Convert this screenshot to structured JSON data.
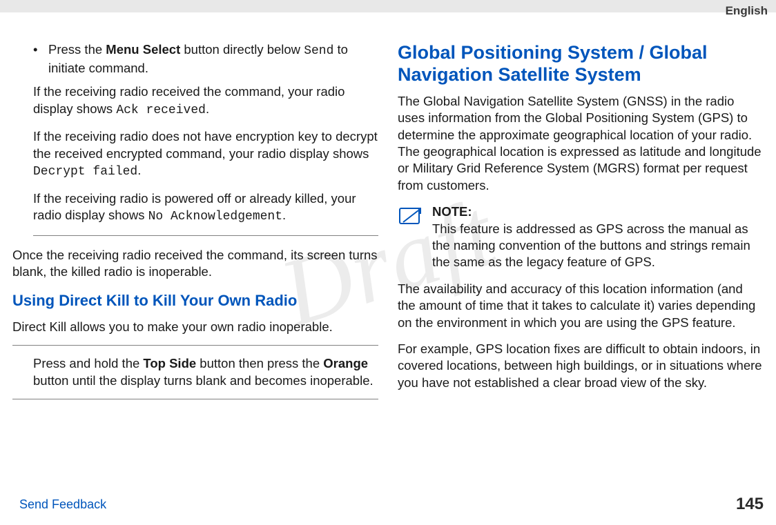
{
  "header": {
    "language": "English"
  },
  "watermark": "Draft",
  "left": {
    "bullet_pre": "Press the ",
    "bullet_bold": "Menu Select",
    "bullet_mid": " button directly below ",
    "bullet_mono": "Send",
    "bullet_post": " to initiate command.",
    "p1_pre": "If the receiving radio received the command, your radio display shows ",
    "p1_mono": "Ack received",
    "p1_post": ".",
    "p2_pre": "If the receiving radio does not have encryption key to decrypt the received encrypted command, your radio display shows ",
    "p2_mono": "Decrypt failed",
    "p2_post": ".",
    "p3_pre": "If the receiving radio is powered off or already killed, your radio display shows ",
    "p3_mono": "No Acknowledgement",
    "p3_post": ".",
    "after_hr": "Once the receiving radio received the command, its screen turns blank, the killed radio is inoperable.",
    "subhead": "Using Direct Kill to Kill Your Own Radio",
    "sub_intro": "Direct Kill allows you to make your own radio inoperable.",
    "step_pre": "Press and hold the ",
    "step_b1": "Top Side",
    "step_mid": " button then press the ",
    "step_b2": "Orange",
    "step_post": " button until the display turns blank and becomes inoperable."
  },
  "right": {
    "mainhead": "Global Positioning System / Global Navigation Satellite System",
    "p1": "The Global Navigation Satellite System (GNSS) in the radio uses information from the Global Positioning System (GPS) to determine the approximate geographical location of your radio. The geographical location is expressed as latitude and longitude or Military Grid Reference System (MGRS) format per request from customers.",
    "note_title": "NOTE:",
    "note_body": "This feature is addressed as GPS across the manual as the naming convention of the buttons and strings remain the same as the legacy feature of GPS.",
    "p2": "The availability and accuracy of this location information (and the amount of time that it takes to calculate it) varies depending on the environment in which you are using the GPS feature.",
    "p3": "For example, GPS location fixes are difficult to obtain indoors, in covered locations, between high buildings, or in situations where you have not established a clear broad view of the sky."
  },
  "footer": {
    "feedback": "Send Feedback",
    "page": "145"
  }
}
